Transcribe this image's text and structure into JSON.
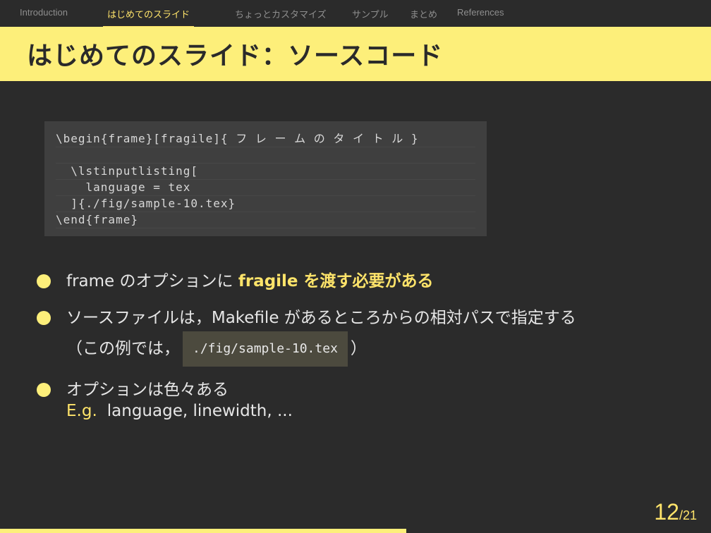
{
  "nav": {
    "items": [
      "Introduction",
      "はじめてのスライド",
      "ちょっとカスタマイズ",
      "サンプル",
      "まとめ",
      "References"
    ],
    "active_index": 1
  },
  "title": "はじめてのスライド：ソースコード",
  "code_lines": [
    "\\begin{frame}[fragile]{ フ レ ー ム の タ イ ト ル }",
    "",
    "  \\lstinputlisting[",
    "    language = tex",
    "  ]{./fig/sample-10.tex}",
    "\\end{frame}"
  ],
  "bullets": {
    "b1_text": "frame のオプションに ",
    "b1_highlight": "fragile を渡す必要がある",
    "b2_line1": "ソースファイルは，Makefile があるところからの相対パスで指定する",
    "b2_prefix": "（この例では，",
    "b2_code": "./fig/sample-10.tex",
    "b2_suffix": "）",
    "b3_text": "オプションは色々ある"
  },
  "example": {
    "label": "E.g.",
    "text": "language, linewidth, ..."
  },
  "page": {
    "current": "12",
    "total": "/21",
    "progress": 0.571
  },
  "colors": {
    "accent": "#fdef7a",
    "background": "#2b2b2b",
    "code_bg": "#3f3f3f"
  }
}
